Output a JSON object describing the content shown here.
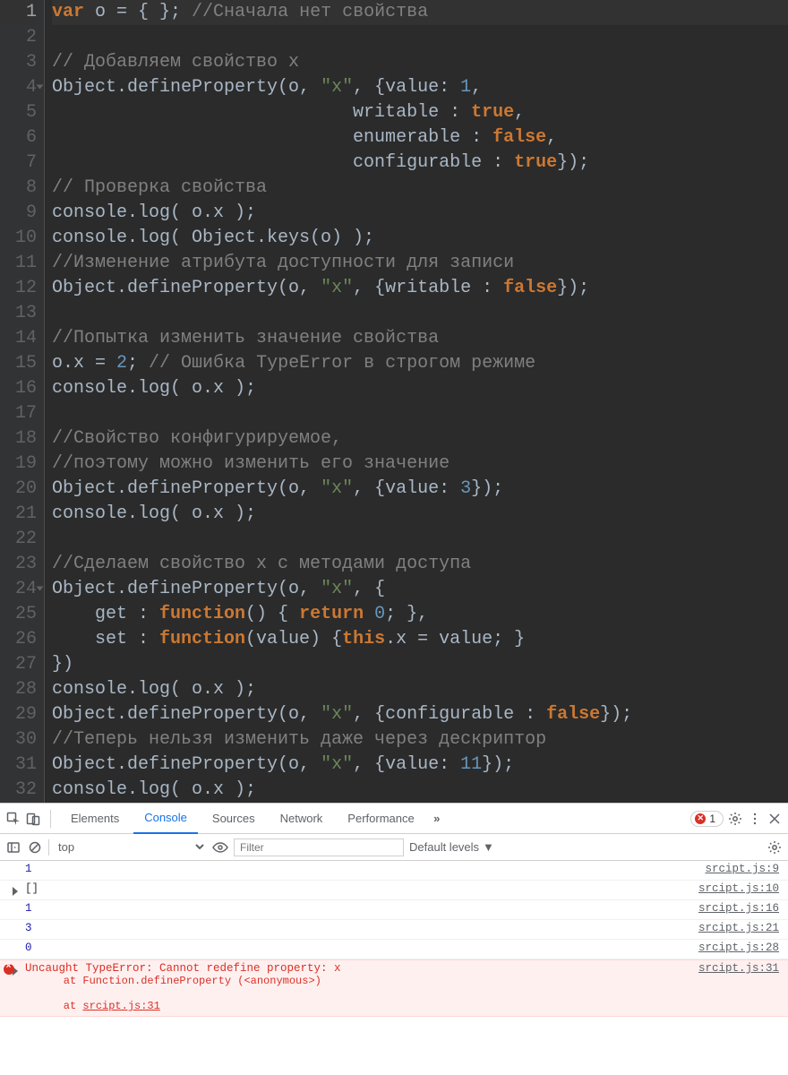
{
  "editor": {
    "lines": [
      {
        "n": 1,
        "hl": true,
        "fold": false,
        "tokens": [
          [
            "kw",
            "var"
          ],
          [
            "",
            " o = { }; "
          ],
          [
            "cmt",
            "//Сначала нет свойства"
          ]
        ]
      },
      {
        "n": 2,
        "tokens": [
          [
            "",
            ""
          ]
        ]
      },
      {
        "n": 3,
        "tokens": [
          [
            "cmt",
            "// Добавляем свойство x"
          ]
        ]
      },
      {
        "n": 4,
        "fold": true,
        "tokens": [
          [
            "",
            "Object.defineProperty(o, "
          ],
          [
            "str",
            "\"x\""
          ],
          [
            "",
            ", {value: "
          ],
          [
            "num",
            "1"
          ],
          [
            "",
            ","
          ]
        ]
      },
      {
        "n": 5,
        "tokens": [
          [
            "",
            "                            writable : "
          ],
          [
            "bool",
            "true"
          ],
          [
            "",
            ","
          ]
        ]
      },
      {
        "n": 6,
        "tokens": [
          [
            "",
            "                            enumerable : "
          ],
          [
            "bool",
            "false"
          ],
          [
            "",
            ","
          ]
        ]
      },
      {
        "n": 7,
        "tokens": [
          [
            "",
            "                            configurable : "
          ],
          [
            "bool",
            "true"
          ],
          [
            "",
            "});"
          ]
        ]
      },
      {
        "n": 8,
        "tokens": [
          [
            "cmt",
            "// Проверка свойства"
          ]
        ]
      },
      {
        "n": 9,
        "tokens": [
          [
            "",
            "console.log( o.x );"
          ]
        ]
      },
      {
        "n": 10,
        "tokens": [
          [
            "",
            "console.log( Object.keys(o) );"
          ]
        ]
      },
      {
        "n": 11,
        "tokens": [
          [
            "cmt",
            "//Изменение атрибута доступности для записи"
          ]
        ]
      },
      {
        "n": 12,
        "tokens": [
          [
            "",
            "Object.defineProperty(o, "
          ],
          [
            "str",
            "\"x\""
          ],
          [
            "",
            ", {writable : "
          ],
          [
            "bool",
            "false"
          ],
          [
            "",
            "});"
          ]
        ]
      },
      {
        "n": 13,
        "tokens": [
          [
            "",
            ""
          ]
        ]
      },
      {
        "n": 14,
        "tokens": [
          [
            "cmt",
            "//Попытка изменить значение свойства"
          ]
        ]
      },
      {
        "n": 15,
        "tokens": [
          [
            "",
            "o.x = "
          ],
          [
            "num",
            "2"
          ],
          [
            "",
            "; "
          ],
          [
            "cmt",
            "// Ошибка TypeError в строгом режиме"
          ]
        ]
      },
      {
        "n": 16,
        "tokens": [
          [
            "",
            "console.log( o.x );"
          ]
        ]
      },
      {
        "n": 17,
        "tokens": [
          [
            "",
            ""
          ]
        ]
      },
      {
        "n": 18,
        "tokens": [
          [
            "cmt",
            "//Свойство конфигурируемое,"
          ]
        ]
      },
      {
        "n": 19,
        "tokens": [
          [
            "cmt",
            "//поэтому можно изменить его значение"
          ]
        ]
      },
      {
        "n": 20,
        "tokens": [
          [
            "",
            "Object.defineProperty(o, "
          ],
          [
            "str",
            "\"x\""
          ],
          [
            "",
            ", {value: "
          ],
          [
            "num",
            "3"
          ],
          [
            "",
            "});"
          ]
        ]
      },
      {
        "n": 21,
        "tokens": [
          [
            "",
            "console.log( o.x );"
          ]
        ]
      },
      {
        "n": 22,
        "tokens": [
          [
            "",
            ""
          ]
        ]
      },
      {
        "n": 23,
        "tokens": [
          [
            "cmt",
            "//Сделаем свойство x с методами доступа"
          ]
        ]
      },
      {
        "n": 24,
        "fold": true,
        "tokens": [
          [
            "",
            "Object.defineProperty(o, "
          ],
          [
            "str",
            "\"x\""
          ],
          [
            "",
            ", {"
          ]
        ]
      },
      {
        "n": 25,
        "tokens": [
          [
            "",
            "    get : "
          ],
          [
            "fnkw",
            "function"
          ],
          [
            "",
            "() { "
          ],
          [
            "ret",
            "return"
          ],
          [
            "",
            " "
          ],
          [
            "num",
            "0"
          ],
          [
            "",
            "; },"
          ]
        ]
      },
      {
        "n": 26,
        "tokens": [
          [
            "",
            "    set : "
          ],
          [
            "fnkw",
            "function"
          ],
          [
            "",
            "(value) {"
          ],
          [
            "this",
            "this"
          ],
          [
            "",
            ".x = value; }"
          ]
        ]
      },
      {
        "n": 27,
        "tokens": [
          [
            "",
            "})"
          ]
        ]
      },
      {
        "n": 28,
        "tokens": [
          [
            "",
            "console.log( o.x );"
          ]
        ]
      },
      {
        "n": 29,
        "tokens": [
          [
            "",
            "Object.defineProperty(o, "
          ],
          [
            "str",
            "\"x\""
          ],
          [
            "",
            ", {configurable : "
          ],
          [
            "bool",
            "false"
          ],
          [
            "",
            "});"
          ]
        ]
      },
      {
        "n": 30,
        "tokens": [
          [
            "cmt",
            "//Теперь нельзя изменить даже через дескриптор"
          ]
        ]
      },
      {
        "n": 31,
        "tokens": [
          [
            "",
            "Object.defineProperty(o, "
          ],
          [
            "str",
            "\"x\""
          ],
          [
            "",
            ", {value: "
          ],
          [
            "num",
            "11"
          ],
          [
            "",
            "});"
          ]
        ]
      },
      {
        "n": 32,
        "tokens": [
          [
            "",
            "console.log( o.x );"
          ]
        ]
      }
    ]
  },
  "devtools": {
    "tabs": {
      "elements": "Elements",
      "console": "Console",
      "sources": "Sources",
      "network": "Network",
      "performance": "Performance"
    },
    "error_count": "1",
    "toolbar": {
      "context": "top",
      "filter_placeholder": "Filter",
      "levels": "Default levels"
    },
    "log": [
      {
        "type": "num",
        "value": "1",
        "src": "srcipt.js:9"
      },
      {
        "type": "arr",
        "value": "[]",
        "src": "srcipt.js:10",
        "expandable": true
      },
      {
        "type": "num",
        "value": "1",
        "src": "srcipt.js:16"
      },
      {
        "type": "num",
        "value": "3",
        "src": "srcipt.js:21"
      },
      {
        "type": "num",
        "value": "0",
        "src": "srcipt.js:28"
      },
      {
        "type": "err",
        "expandable": true,
        "src": "srcipt.js:31",
        "message": "Uncaught TypeError: Cannot redefine property: x",
        "trace": [
          "at Function.defineProperty (<anonymous>)",
          "at srcipt.js:31"
        ]
      }
    ]
  }
}
